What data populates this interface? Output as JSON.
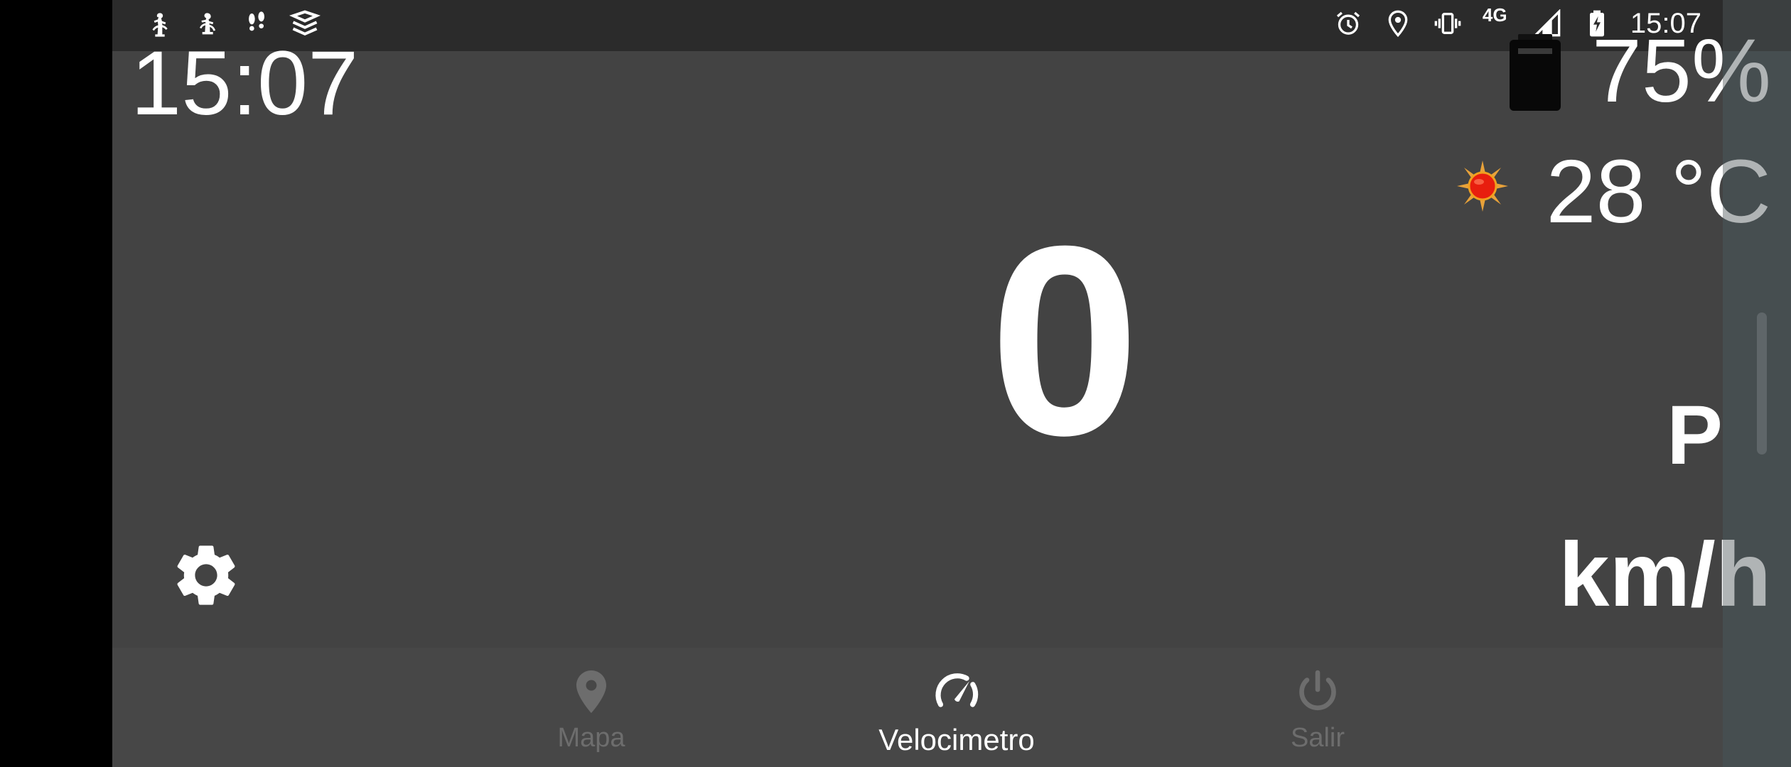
{
  "status_bar": {
    "left_icons": [
      "sb-app-icon-1",
      "sb-app-icon-2",
      "footsteps-icon",
      "layers-icon"
    ],
    "right_icons": [
      "alarm-icon",
      "location-icon",
      "vibrate-icon",
      "network-4g-icon",
      "signal-icon",
      "battery-charging-icon"
    ],
    "network": "4G",
    "time": "15:07"
  },
  "dashboard": {
    "clock": "15:07",
    "battery_value": "75%",
    "battery_icon": "battery-icon",
    "temperature": "28 °C",
    "weather_icon": "sun-icon",
    "speed": "0",
    "gear": "P",
    "unit": "km/h",
    "settings_icon": "gear-icon"
  },
  "nav": {
    "items": [
      {
        "label": "Mapa",
        "icon": "map-pin-icon",
        "active": false
      },
      {
        "label": "Velocimetro",
        "icon": "speedometer-icon",
        "active": true
      },
      {
        "label": "Salir",
        "icon": "power-icon",
        "active": false
      }
    ]
  },
  "colors": {
    "background": "#434343",
    "status_bar": "#2b2b2b",
    "nav_bar": "#474747",
    "text": "#ffffff",
    "inactive": "#6d6d6d"
  }
}
